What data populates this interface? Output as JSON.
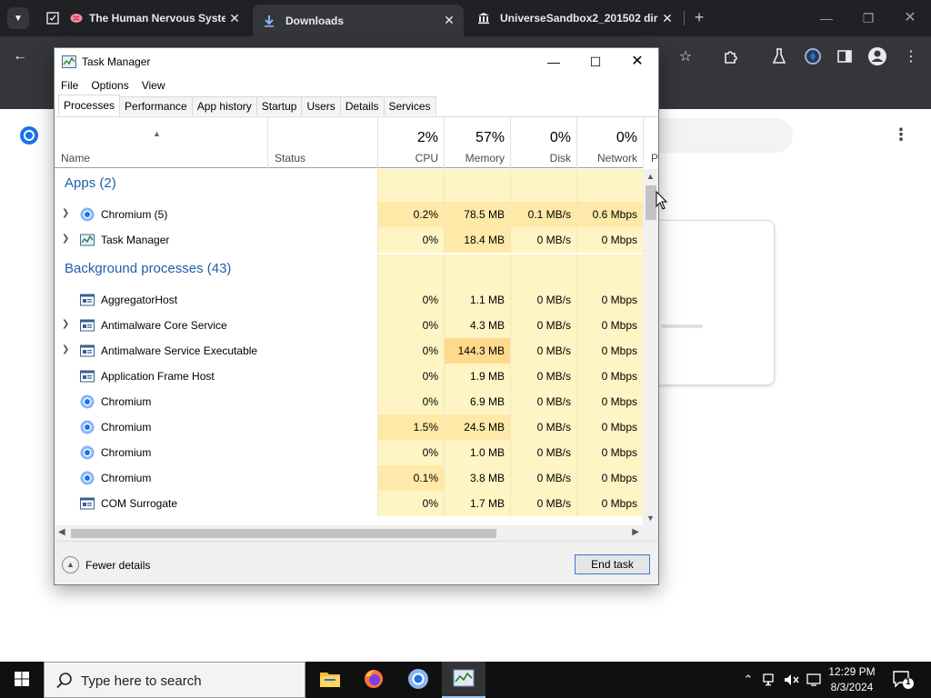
{
  "browser": {
    "tabs": [
      {
        "title": "The Human Nervous Syster",
        "active": false
      },
      {
        "title": "Downloads",
        "active": true
      },
      {
        "title": "UniverseSandbox2_201502 dir",
        "active": false
      }
    ],
    "new_tab": "+"
  },
  "taskmanager": {
    "title": "Task Manager",
    "menu": [
      "File",
      "Options",
      "View"
    ],
    "tabs": [
      "Processes",
      "Performance",
      "App history",
      "Startup",
      "Users",
      "Details",
      "Services"
    ],
    "columns": {
      "name": "Name",
      "status": "Status",
      "cpu": {
        "pct": "2%",
        "label": "CPU"
      },
      "memory": {
        "pct": "57%",
        "label": "Memory"
      },
      "disk": {
        "pct": "0%",
        "label": "Disk"
      },
      "network": {
        "pct": "0%",
        "label": "Network"
      },
      "power": "P"
    },
    "groups": {
      "apps": "Apps (2)",
      "background": "Background processes (43)"
    },
    "apps": [
      {
        "name": "Chromium (5)",
        "icon": "chromium-icon",
        "expandable": true,
        "cpu": "0.2%",
        "memory": "78.5 MB",
        "disk": "0.1 MB/s",
        "network": "0.6 Mbps"
      },
      {
        "name": "Task Manager",
        "icon": "task-manager-icon",
        "expandable": true,
        "cpu": "0%",
        "memory": "18.4 MB",
        "disk": "0 MB/s",
        "network": "0 Mbps"
      }
    ],
    "background": [
      {
        "name": "AggregatorHost",
        "icon": "service-icon",
        "expandable": false,
        "cpu": "0%",
        "memory": "1.1 MB",
        "disk": "0 MB/s",
        "network": "0 Mbps"
      },
      {
        "name": "Antimalware Core Service",
        "icon": "service-icon",
        "expandable": true,
        "cpu": "0%",
        "memory": "4.3 MB",
        "disk": "0 MB/s",
        "network": "0 Mbps"
      },
      {
        "name": "Antimalware Service Executable",
        "icon": "service-icon",
        "expandable": true,
        "cpu": "0%",
        "memory": "144.3 MB",
        "disk": "0 MB/s",
        "network": "0 Mbps"
      },
      {
        "name": "Application Frame Host",
        "icon": "service-icon",
        "expandable": false,
        "cpu": "0%",
        "memory": "1.9 MB",
        "disk": "0 MB/s",
        "network": "0 Mbps"
      },
      {
        "name": "Chromium",
        "icon": "chromium-icon",
        "expandable": false,
        "cpu": "0%",
        "memory": "6.9 MB",
        "disk": "0 MB/s",
        "network": "0 Mbps"
      },
      {
        "name": "Chromium",
        "icon": "chromium-icon",
        "expandable": false,
        "cpu": "1.5%",
        "memory": "24.5 MB",
        "disk": "0 MB/s",
        "network": "0 Mbps"
      },
      {
        "name": "Chromium",
        "icon": "chromium-icon",
        "expandable": false,
        "cpu": "0%",
        "memory": "1.0 MB",
        "disk": "0 MB/s",
        "network": "0 Mbps"
      },
      {
        "name": "Chromium",
        "icon": "chromium-icon",
        "expandable": false,
        "cpu": "0.1%",
        "memory": "3.8 MB",
        "disk": "0 MB/s",
        "network": "0 Mbps"
      },
      {
        "name": "COM Surrogate",
        "icon": "service-icon",
        "expandable": false,
        "cpu": "0%",
        "memory": "1.7 MB",
        "disk": "0 MB/s",
        "network": "0 Mbps"
      }
    ],
    "fewer_details": "Fewer details",
    "end_task": "End task"
  },
  "taskbar": {
    "search_placeholder": "Type here to search",
    "time": "12:29 PM",
    "date": "8/3/2024",
    "notification_count": "1"
  },
  "colors": {
    "heat_light": "#fff4c4",
    "heat_medium": "#ffe9a8",
    "heat_strong": "#ffd98c",
    "group_text": "#1f5fa8",
    "chrome_dark": "#202124"
  }
}
